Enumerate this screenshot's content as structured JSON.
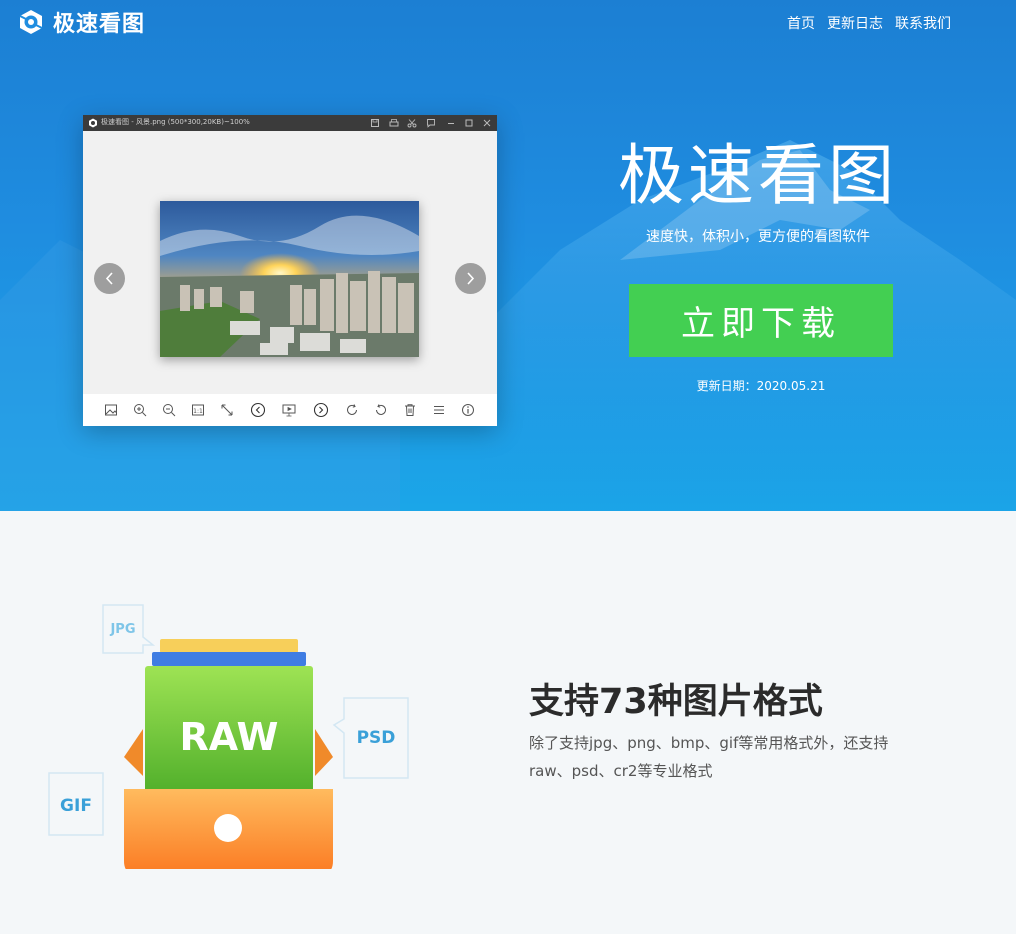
{
  "header": {
    "brand": "极速看图",
    "nav": [
      "首页",
      "更新日志",
      "联系我们"
    ]
  },
  "app_window": {
    "title": "极速看图 - 风景.png (500*300,20KB)~100%",
    "toolbar_icons": [
      "image-icon",
      "zoom-in-icon",
      "zoom-out-icon",
      "actual-size-icon",
      "fullscreen-icon",
      "previous-icon",
      "slideshow-icon",
      "next-icon",
      "rotate-right-icon",
      "rotate-left-icon",
      "delete-icon",
      "menu-icon",
      "info-icon"
    ]
  },
  "hero": {
    "title": "极速看图",
    "subtitle": "速度快，体积小，更方便的看图软件",
    "download_label": "立即下载",
    "update_date": "更新日期：2020.05.21"
  },
  "feature": {
    "title": "支持73种图片格式",
    "description": "除了支持jpg、png、bmp、gif等常用格式外，还支持raw、psd、cr2等专业格式",
    "formats": [
      "JPG",
      "RAW",
      "PSD",
      "GIF"
    ]
  },
  "colors": {
    "hero_blue": "#1f8de0",
    "download_green": "#43cf52",
    "drawer_orange": "#f7943a",
    "raw_green": "#6cc13a",
    "format_text_blue": "#3aa0d8"
  }
}
